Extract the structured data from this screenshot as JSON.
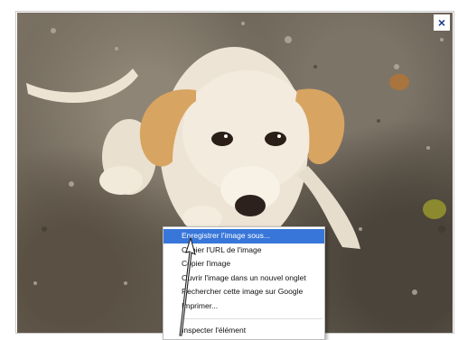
{
  "viewer": {
    "close_label": "×",
    "close_icon": "close-icon",
    "accent": "#1a3b8a"
  },
  "context_menu": {
    "highlight_color": "#3876d9",
    "items": [
      {
        "label": "Enregistrer l'image sous...",
        "highlighted": true
      },
      {
        "label": "Copier l'URL de l'image"
      },
      {
        "label": "Copier l'image"
      },
      {
        "label": "Ouvrir l'image dans un nouvel onglet"
      },
      {
        "label": "Rechercher cette image sur Google"
      },
      {
        "label": "Imprimer..."
      }
    ],
    "inspect_label": "Inspecter l'élément"
  },
  "cursor": "arrow-cursor-icon"
}
